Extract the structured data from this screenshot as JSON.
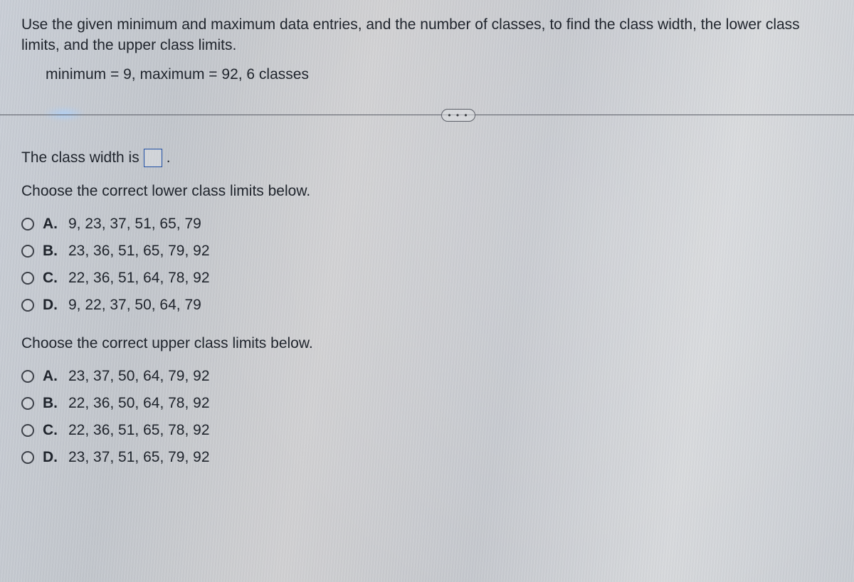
{
  "instructions": "Use the given minimum and maximum data entries, and the number of classes, to find the class width, the lower class limits, and the upper class limits.",
  "params": "minimum = 9,  maximum = 92, 6 classes",
  "more_pill": "• • •",
  "class_width": {
    "prefix": "The class width is",
    "suffix": "."
  },
  "lower_prompt": "Choose the correct lower class limits below.",
  "lower_options": [
    {
      "letter": "A.",
      "text": "9, 23, 37, 51, 65, 79"
    },
    {
      "letter": "B.",
      "text": "23, 36, 51, 65, 79, 92"
    },
    {
      "letter": "C.",
      "text": "22, 36, 51, 64, 78, 92"
    },
    {
      "letter": "D.",
      "text": "9, 22, 37, 50, 64, 79"
    }
  ],
  "upper_prompt": "Choose the correct upper class limits below.",
  "upper_options": [
    {
      "letter": "A.",
      "text": "23, 37, 50, 64, 79, 92"
    },
    {
      "letter": "B.",
      "text": "22, 36, 50, 64, 78, 92"
    },
    {
      "letter": "C.",
      "text": "22, 36, 51, 65, 78, 92"
    },
    {
      "letter": "D.",
      "text": "23, 37, 51, 65, 79, 92"
    }
  ]
}
